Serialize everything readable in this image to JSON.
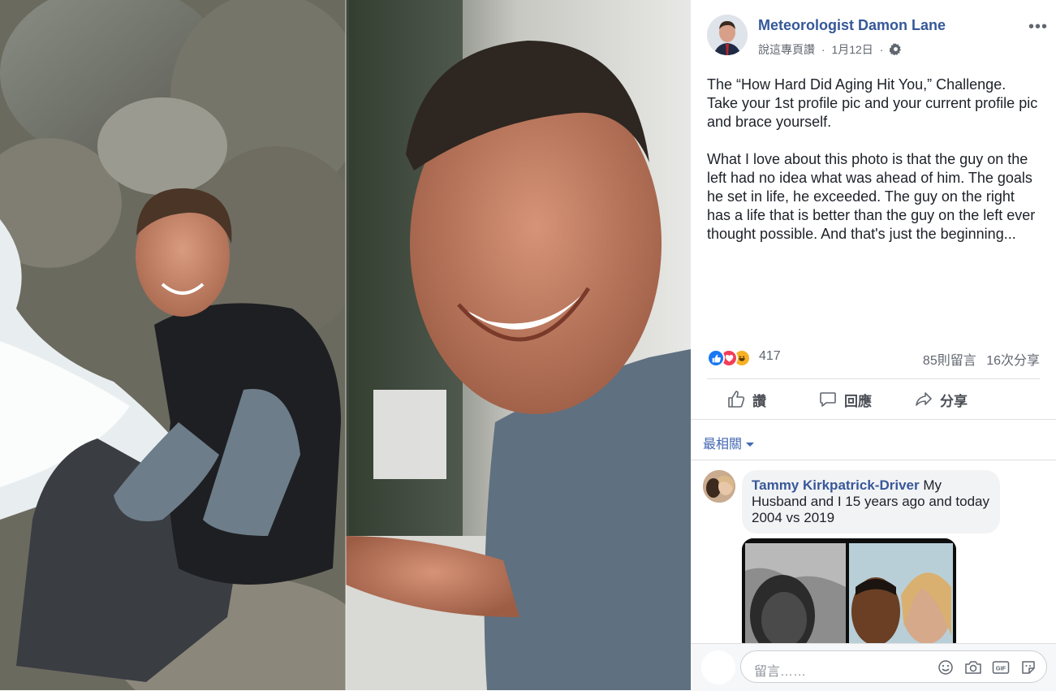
{
  "post": {
    "author": "Meteorologist Damon Lane",
    "meta_link": "說這專頁讚",
    "sep1": "·",
    "date": "1月12日",
    "sep2": "·",
    "more": "•••",
    "text_p1": "The “How Hard Did Aging Hit You,” Challenge. Take your 1st profile pic and your current profile pic and brace yourself.",
    "text_p2": "What I love about this photo is that the guy on the left had no idea what was ahead of him. The goals he set in life, he exceeded. The guy on the right has a life that is better than the guy on the left ever thought possible. And that's just the beginning..."
  },
  "reactions": {
    "count": "417",
    "comments": "85則留言",
    "shares": "16次分享",
    "icons": [
      "like-icon",
      "love-icon",
      "haha-icon"
    ],
    "colors": {
      "like": "#1877f2",
      "love": "#f33e58",
      "haha": "#f7b125"
    }
  },
  "actions": {
    "like": "讚",
    "comment": "回應",
    "share": "分享"
  },
  "comments": {
    "sort_label": "最相關",
    "items": [
      {
        "name": "Tammy Kirkpatrick-Driver",
        "text": "My Husband and I 15 years ago and today 2004 vs 2019"
      }
    ]
  },
  "composer": {
    "placeholder": "留言……",
    "icons": [
      "emoji-icon",
      "camera-icon",
      "gif-icon",
      "sticker-icon"
    ]
  },
  "colors": {
    "link": "#365899",
    "accent": "#4267b2"
  }
}
